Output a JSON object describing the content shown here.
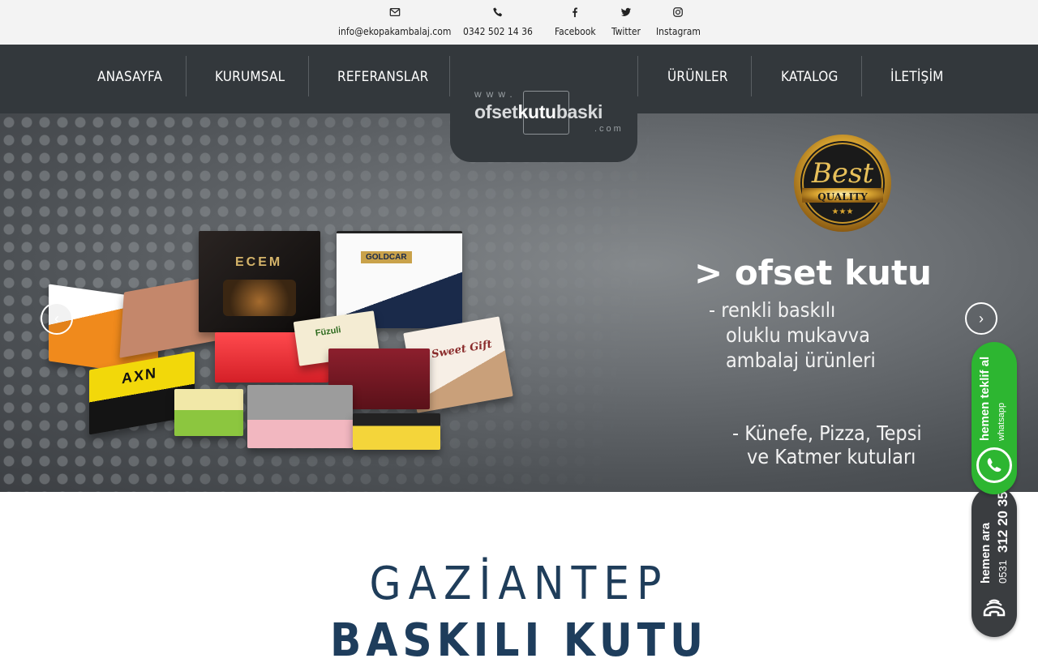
{
  "topbar": {
    "email": "info@ekopakambalaj.com",
    "phone": "0342 502 14 36",
    "facebook": "Facebook",
    "twitter": "Twitter",
    "instagram": "Instagram"
  },
  "nav": {
    "left": [
      "ANASAYFA",
      "KURUMSAL",
      "REFERANSLAR"
    ],
    "right": [
      "ÜRÜNLER",
      "KATALOG",
      "İLETİŞİM"
    ]
  },
  "logo": {
    "www": "www.",
    "part1": "ofset",
    "part2": "kutu",
    "part3": "baski",
    "com": ".com"
  },
  "hero": {
    "badge_line1": "Best",
    "badge_line2": "QUALITY",
    "badge_stars": "★★★",
    "headline": "> ofset kutu",
    "line1": "- renkli baskılı",
    "line2": "oluklu mukavva",
    "line3": "ambalaj ürünleri",
    "line4": "- Künefe, Pizza, Tepsi",
    "line5": "ve Katmer kutuları",
    "prev": "‹",
    "next": "›"
  },
  "products": {
    "ecem": "ECEM",
    "goldcar": "GOLDCAR",
    "axn": "AXN",
    "sweet": "Sweet Gift",
    "fuzzuli": "Füzuli"
  },
  "whatsapp": {
    "title": "hemen teklif al",
    "sub": "whatsapp"
  },
  "call": {
    "title": "hemen ara",
    "prefix": "0531",
    "number": "312 20 35"
  },
  "section": {
    "heading1": "GAZİANTEP",
    "heading2": "BASKILI KUTU"
  },
  "colors": {
    "nav_bg": "#33383c",
    "whatsapp": "#2db631",
    "heading": "#1f3d5a"
  }
}
